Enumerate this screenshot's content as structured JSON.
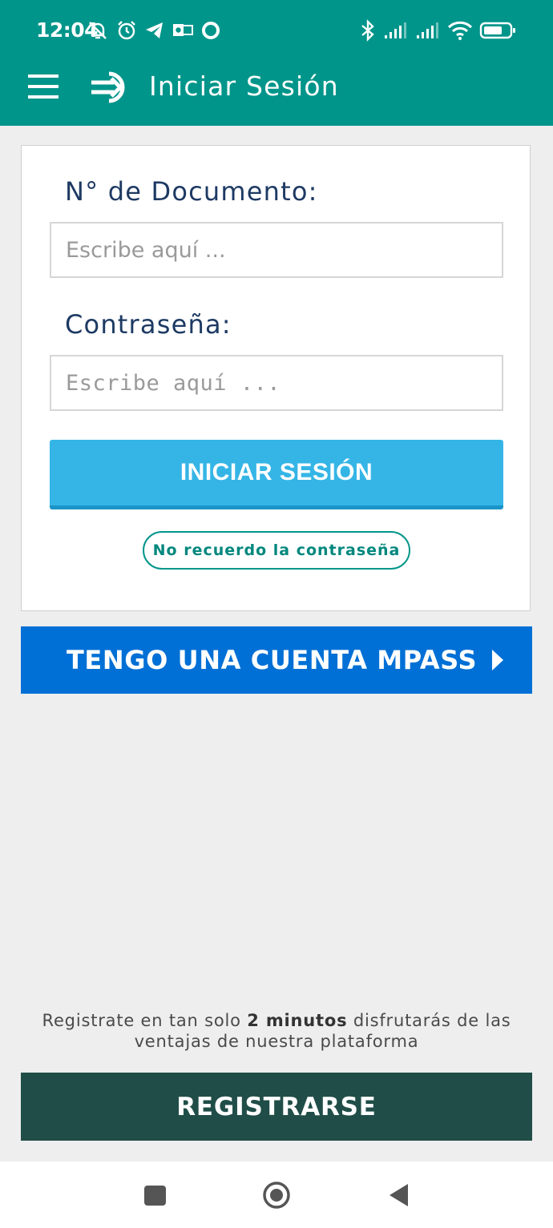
{
  "status_bar": {
    "time": "12:04"
  },
  "app_bar": {
    "title": "Iniciar Sesión"
  },
  "login_form": {
    "document_label": "N° de Documento:",
    "document_placeholder": "Escribe aquí ...",
    "password_label": "Contraseña:",
    "password_placeholder": "Escribe aquí ...",
    "login_button": "INICIAR SESIÓN",
    "forgot_password": "No recuerdo la contraseña"
  },
  "mpass": {
    "label": "TENGO UNA CUENTA MPASS"
  },
  "promo": {
    "before": "Registrate en tan solo ",
    "bold": "2 minutos",
    "after": " disfrutarás de las ventajas de nuestra plataforma"
  },
  "register": {
    "label": "REGISTRARSE"
  },
  "colors": {
    "header": "#00958a",
    "login_button": "#35b5e6",
    "mpass_button": "#0070d6",
    "register_button": "#204d48",
    "label_text": "#1d3a63"
  },
  "icons": {
    "status_left": [
      "muted-bell-icon",
      "alarm-icon",
      "telegram-icon",
      "outlook-icon",
      "circle-icon"
    ],
    "status_right": [
      "bluetooth-icon",
      "signal-icon",
      "signal-icon",
      "wifi-icon",
      "battery-icon"
    ],
    "app_bar": [
      "menu-icon",
      "login-arrow-icon"
    ],
    "nav": [
      "recent-apps-icon",
      "home-icon",
      "back-icon"
    ]
  }
}
